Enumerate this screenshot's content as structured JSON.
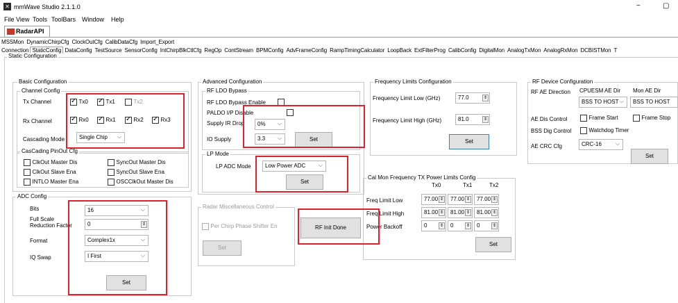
{
  "window": {
    "title": "mmWave Studio 2.1.1.0",
    "minimize": "−",
    "restore": "▢"
  },
  "menu": [
    "File",
    "View",
    "Tools",
    "ToolBars",
    "Window",
    "Help"
  ],
  "api_tab": "RadarAPI",
  "tabs_row1": [
    "MSSMon",
    "DynamicChirpCfg",
    "ClockOutCfg",
    "CalibDataCfg",
    "Import_Export"
  ],
  "tabs_row2": [
    "Connection",
    "StaticConfig",
    "DataConfig",
    "TestSource",
    "SensorConfig",
    "IntChirpBlkCtlCfg",
    "RegOp",
    "ContStream",
    "BPMConfig",
    "AdvFrameConfig",
    "RampTimingCalculator",
    "LoopBack",
    "ExtFilterProg",
    "CalibConfig",
    "DigitalMon",
    "AnalogTxMon",
    "AnalogRxMon",
    "DCBISTMon",
    "T"
  ],
  "active_tab": "StaticConfig",
  "static_config_title": "Static Configuration",
  "basic": {
    "title": "Basic Configuration",
    "channel_title": "Channel Config",
    "tx_label": "Tx Channel",
    "tx": [
      {
        "label": "Tx0",
        "checked": true
      },
      {
        "label": "Tx1",
        "checked": true
      },
      {
        "label": "Tx2",
        "checked": false
      }
    ],
    "rx_label": "Rx Channel",
    "rx": [
      {
        "label": "Rx0",
        "checked": true
      },
      {
        "label": "Rx1",
        "checked": true
      },
      {
        "label": "Rx2",
        "checked": true
      },
      {
        "label": "Rx3",
        "checked": true
      }
    ],
    "cascading_label": "Cascading Mode",
    "cascading_value": "Single Chip",
    "pinout_title": "CasCading PinOut Cfg",
    "pinout": [
      "ClkOut Master Dis",
      "SyncOut Master Dis",
      "ClkOut Slave Ena",
      "SyncOut Slave Ena",
      "INTLO Master Ena",
      "OSCClkOut Master Dis"
    ]
  },
  "adc": {
    "title": "ADC Config",
    "bits_label": "Bits",
    "bits_value": "16",
    "fsr_label1": "Full Scale",
    "fsr_label2": "Reduction Factor",
    "fsr_value": "0",
    "format_label": "Format",
    "format_value": "Complex1x",
    "iq_label": "IQ Swap",
    "iq_value": "I First",
    "set": "Set"
  },
  "advanced": {
    "title": "Advanced Configuration",
    "ldo_title": "RF LDO Bypass",
    "ldo_enable": "RF LDO Bypass Enable",
    "paldo": "PALDO I/P Disable",
    "ir_drop_label": "Supply IR Drop",
    "ir_drop_value": "0%",
    "io_supply_label": "IO Supply",
    "io_supply_value": "3.3",
    "set": "Set",
    "lp_title": "LP Mode",
    "lp_label": "LP ADC Mode",
    "lp_value": "Low Power ADC",
    "lp_set": "Set"
  },
  "misc": {
    "title": "Radar Miscellaneous Control",
    "per_chirp": "Per Chirp Phase Shifter En",
    "set": "Set",
    "rf_init": "RF Init Done"
  },
  "freq": {
    "title": "Frequency Limits Configuration",
    "low_label": "Frequency Limit Low (GHz)",
    "low_value": "77.0",
    "high_label": "Frequency Limit High (GHz)",
    "high_value": "81.0",
    "set": "Set"
  },
  "calmon": {
    "title": "Cal Mon Frequency TX Power Limits Config",
    "cols": [
      "Tx0",
      "Tx1",
      "Tx2"
    ],
    "rows": [
      {
        "label": "Freq Limit Low",
        "values": [
          "77.00",
          "77.00",
          "77.00"
        ]
      },
      {
        "label": "Freq Limit High",
        "values": [
          "81.00",
          "81.00",
          "81.00"
        ]
      },
      {
        "label": "Power Backoff",
        "values": [
          "0",
          "0",
          "0"
        ]
      }
    ],
    "set": "Set"
  },
  "rfdev": {
    "title": "RF Device Configuration",
    "ae_dir_label": "RF AE Direction",
    "col1": "CPUESM AE Dir",
    "col2": "Mon AE Dir",
    "dir1": "BSS TO HOST",
    "dir2": "BSS TO HOST",
    "ae_dis_label": "AE Dis Control",
    "frame_start": "Frame Start",
    "frame_stop": "Frame Stop",
    "bss_dig_label": "BSS Dig Control",
    "watchdog": "Watchdog Timer",
    "crc_label": "AE CRC Cfg",
    "crc_value": "CRC-16",
    "set": "Set"
  }
}
